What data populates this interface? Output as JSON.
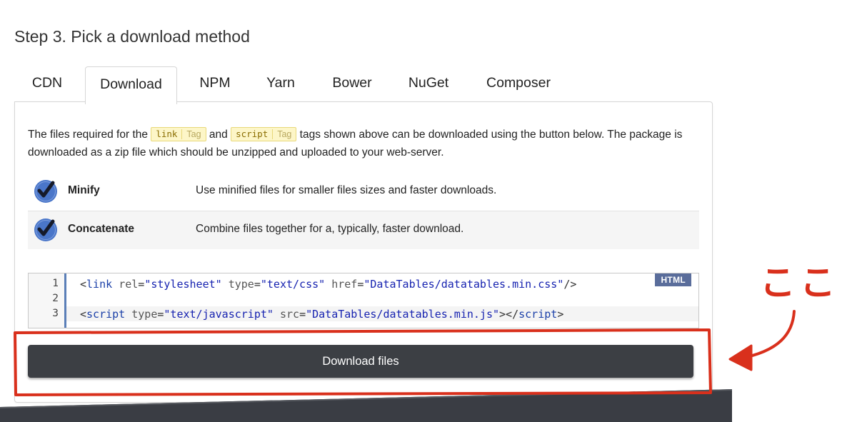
{
  "page": {
    "heading": "Step 3. Pick a download method"
  },
  "tabs": [
    {
      "label": "CDN",
      "active": false
    },
    {
      "label": "Download",
      "active": true
    },
    {
      "label": "NPM",
      "active": false
    },
    {
      "label": "Yarn",
      "active": false
    },
    {
      "label": "Bower",
      "active": false
    },
    {
      "label": "NuGet",
      "active": false
    },
    {
      "label": "Composer",
      "active": false
    }
  ],
  "panel": {
    "desc_part1": "The files required for the ",
    "tag1_name": "link",
    "tag1_suffix": "Tag",
    "desc_part2": " and ",
    "tag2_name": "script",
    "tag2_suffix": "Tag",
    "desc_part3": " tags shown above can be downloaded using the button below. The package is downloaded as a zip file which should be unzipped and uploaded to your web-server.",
    "options": [
      {
        "name": "Minify",
        "description": "Use minified files for smaller files sizes and faster downloads.",
        "checked": true
      },
      {
        "name": "Concatenate",
        "description": "Combine files together for a, typically, faster download.",
        "checked": true
      }
    ],
    "code": {
      "language_badge": "HTML",
      "line_numbers": [
        "1",
        "2",
        "3"
      ],
      "line1": {
        "open": "<",
        "tag": "link",
        "attr1": "rel",
        "val1": "\"stylesheet\"",
        "attr2": "type",
        "val2": "\"text/css\"",
        "attr3": "href",
        "val3": "\"DataTables/datatables.min.css\"",
        "close": "/>"
      },
      "line3": {
        "open": "<",
        "tag": "script",
        "attr1": "type",
        "val1": "\"text/javascript\"",
        "attr2": "src",
        "val2": "\"DataTables/datatables.min.js\"",
        "mid": "></",
        "end_tag": "script",
        "close": ">"
      }
    },
    "download_button_label": "Download files"
  },
  "annotation": {
    "label": "ここ",
    "color": "#d9301c"
  },
  "colors": {
    "button_bg": "#3c3f44",
    "check_blue": "#4a76c9",
    "badge_bg": "#5a6d9b",
    "footer_dark": "#3a3d44"
  }
}
